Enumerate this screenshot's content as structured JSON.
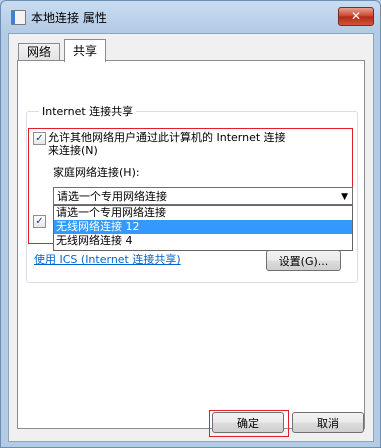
{
  "window": {
    "title": "本地连接 属性",
    "close_label": "✕"
  },
  "tabs": [
    {
      "label": "网络"
    },
    {
      "label": "共享"
    }
  ],
  "sharing": {
    "group_title": "Internet 连接共享",
    "allow_label_line1": "允许其他网络用户通过此计算机的 Internet 连接",
    "allow_label_line2": "来连接(N)",
    "allow_checked": true,
    "home_network_label": "家庭网络连接(H):",
    "home_network_selected": "请选一个专用网络连接",
    "dropdown_options": [
      "请选一个专用网络连接",
      "无线网络连接 12",
      "无线网络连接 4"
    ],
    "dropdown_highlighted_index": 1,
    "second_checked": true,
    "ics_link": "使用 ICS (Internet 连接共享)",
    "settings_button": "设置(G)..."
  },
  "footer": {
    "ok": "确定",
    "cancel": "取消"
  }
}
